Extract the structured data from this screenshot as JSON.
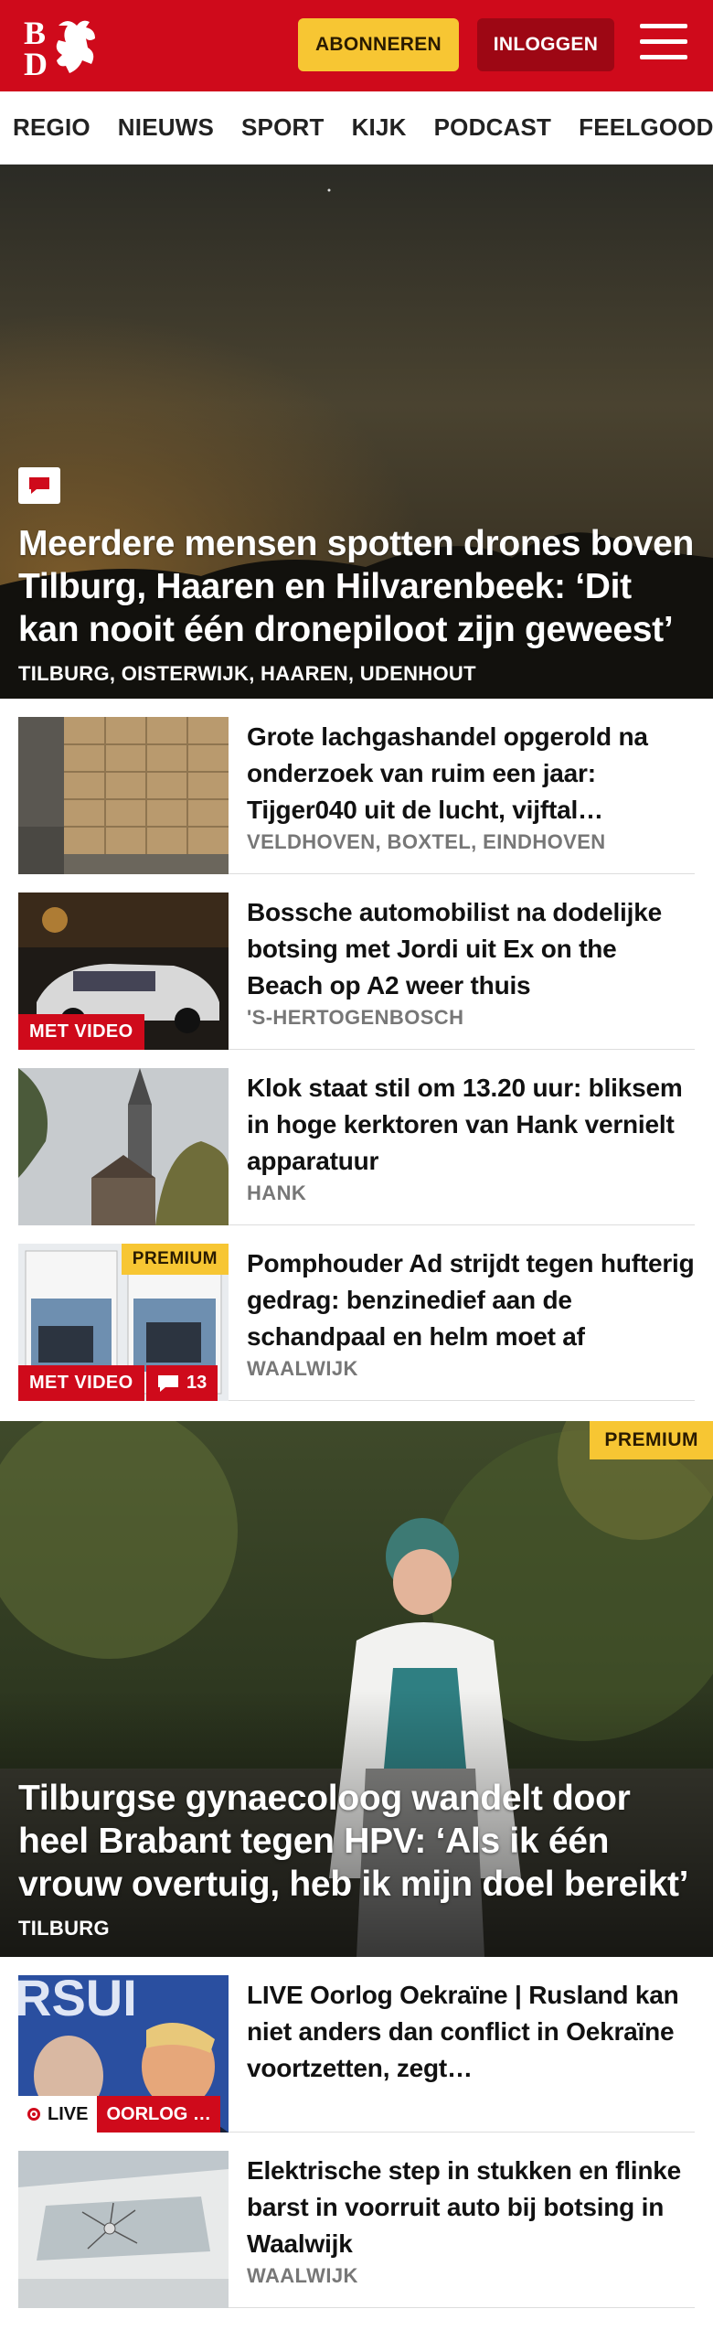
{
  "header": {
    "logo_text": "BD",
    "subscribe_label": "ABONNEREN",
    "login_label": "INLOGGEN"
  },
  "nav": {
    "items": [
      "REGIO",
      "NIEUWS",
      "SPORT",
      "KIJK",
      "PODCAST",
      "FEELGOOD"
    ]
  },
  "hero": {
    "title": "Meerdere mensen spotten drones boven Tilburg, Haaren en Hilvaren­beek: ‘Dit kan nooit één dronepiloot zijn geweest’",
    "location": "TILBURG, OISTERWIJK, HAAREN, UDENHOUT"
  },
  "articles": [
    {
      "title": "Grote lachgashandel opgerold na onderzoek van ruim een jaar: Tijger040 uit de lucht, vijftal…",
      "location": "VELDHOVEN, BOXTEL, EINDHOVEN"
    },
    {
      "title": "Bossche automobilist na dodelijke botsing met Jordi uit Ex on the Beach op A2 weer thuis",
      "location": "'S-HERTOGENBOSCH",
      "badge_video": "MET VIDEO"
    },
    {
      "title": "Klok staat stil om 13.20 uur: bliksem in hoge kerktoren van Hank vernielt apparatuur",
      "location": "HANK"
    },
    {
      "title": "Pomphouder Ad strijdt tegen hufterig gedrag: benzinedief aan de schandpaal en helm moet af",
      "location": "WAALWIJK",
      "badge_video": "MET VIDEO",
      "badge_premium": "PREMIUM",
      "comments": "13"
    }
  ],
  "feature": {
    "premium": "PREMIUM",
    "title": "Tilburgse gynaecoloog wandelt door heel Brabant tegen HPV: ‘Als ik één vrouw overtuig, heb ik mijn doel bereikt’",
    "location": "TILBURG"
  },
  "articles2": [
    {
      "title": "LIVE Oorlog Oekraïne | Rusland kan niet anders dan conflict in Oekraïne voortzetten, zegt…",
      "live_label": "LIVE",
      "topic_label": "OORLOG …"
    },
    {
      "title": "Elektrische step in stukken en flinke barst in voorruit auto bij botsing in Waalwijk",
      "location": "WAALWIJK"
    }
  ],
  "colors": {
    "brand_red": "#cf0a1b",
    "dark_red": "#9d0714",
    "premium_yellow": "#f7c633",
    "meta_gray": "#777777"
  }
}
